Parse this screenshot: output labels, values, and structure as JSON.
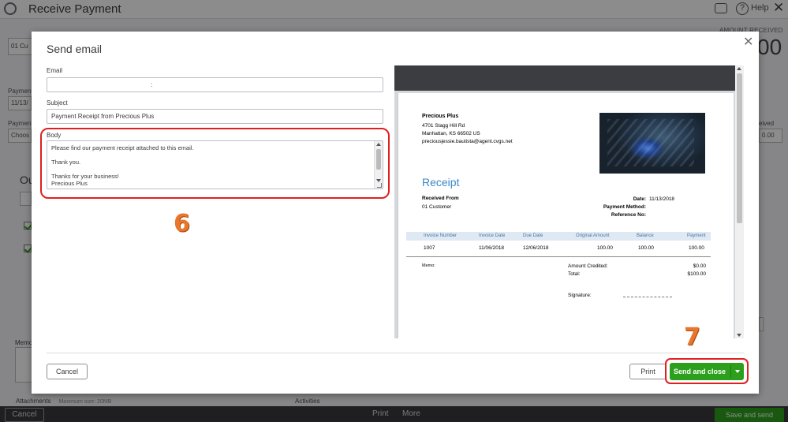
{
  "background": {
    "title": "Receive Payment",
    "help_label": "Help",
    "amount_received_label": "AMOUNT RECEIVED",
    "amount_received_fragment": "00",
    "customer_value": "01 Cu",
    "payment_date_label": "Payment",
    "payment_date_value": "11/13/",
    "payment_method_label": "Payment",
    "payment_method_value": "Choos",
    "received_label": "eived",
    "received_value": "0.00",
    "outstanding_heading": "Ou",
    "memo_label": "Memo",
    "attachments_label": "Attachments",
    "attachments_max": "Maximum size: 20MB",
    "activities_label": "Activities",
    "footer": {
      "cancel": "Cancel",
      "print": "Print",
      "more": "More",
      "save_send": "Save and send"
    }
  },
  "modal": {
    "title": "Send email",
    "email_label": "Email",
    "email_value": ":",
    "subject_label": "Subject",
    "subject_value": "Payment Receipt from Precious Plus",
    "body_label": "Body",
    "body_lines": [
      "Please find our payment receipt attached to this email.",
      "Thank you.",
      "Thanks for your business!",
      "Precious Plus"
    ],
    "cancel_label": "Cancel",
    "print_label": "Print",
    "send_label": "Send and close"
  },
  "annotations": {
    "step_body": "6",
    "step_send": "7",
    "highlight_color": "#e02020",
    "number_color": "#e8762c"
  },
  "receipt": {
    "company_name": "Precious Plus",
    "address_line1": "4701 Stagg Hill Rd",
    "address_line2": "Manhattan, KS  66502 US",
    "email": "preciousjessie.bautista@agent.cvgs.net",
    "title": "Receipt",
    "received_from_label": "Received From",
    "customer": "01 Customer",
    "date_label": "Date:",
    "date_value": "11/13/2018",
    "payment_method_label": "Payment Method:",
    "reference_label": "Reference No:",
    "columns": [
      "Invoice Number",
      "Invoice Date",
      "Due Date",
      "Original Amount",
      "Balance",
      "Payment"
    ],
    "row": [
      "1007",
      "11/06/2018",
      "12/06/2018",
      "100.00",
      "100.00",
      "100.00"
    ],
    "memo_label": "Memo:",
    "amount_credited_label": "Amount Credited:",
    "amount_credited_value": "$0.00",
    "total_label": "Total:",
    "total_value": "$100.00",
    "signature_label": "Signature:"
  },
  "colors": {
    "accent_green": "#2ca01c",
    "receipt_blue": "#3b86c9"
  }
}
